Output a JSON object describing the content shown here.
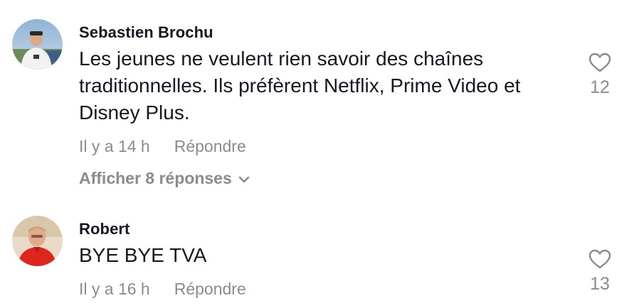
{
  "comments": [
    {
      "author": "Sebastien Brochu",
      "text": "Les jeunes ne veulent rien savoir des chaînes traditionnelles. Ils préfèrent Netflix, Prime Video et Disney Plus.",
      "time": "Il y a 14 h",
      "reply_label": "Répondre",
      "show_replies_label": "Afficher 8 réponses",
      "likes": "12",
      "icon": "heart-outline-icon"
    },
    {
      "author": "Robert",
      "text": "BYE BYE TVA",
      "time": "Il y a 16 h",
      "reply_label": "Répondre",
      "likes": "13",
      "icon": "heart-outline-icon"
    }
  ],
  "colors": {
    "text": "#161823",
    "muted": "#8a8b91"
  }
}
